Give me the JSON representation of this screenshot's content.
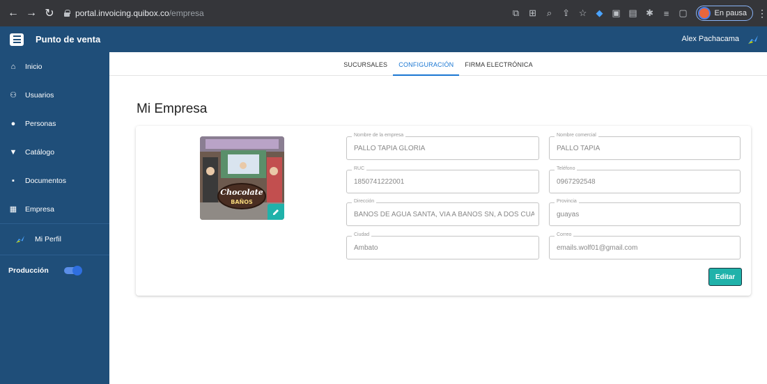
{
  "browser": {
    "url_host": "portal.invoicing.quibox.co",
    "url_path": "/empresa",
    "profile_status": "En pausa"
  },
  "header": {
    "title": "Punto de venta",
    "user_name": "Alex Pachacama"
  },
  "sidebar": {
    "items": [
      {
        "label": "Inicio",
        "icon": "home-icon"
      },
      {
        "label": "Usuarios",
        "icon": "users-icon"
      },
      {
        "label": "Personas",
        "icon": "person-icon"
      },
      {
        "label": "Catálogo",
        "icon": "cart-icon"
      },
      {
        "label": "Documentos",
        "icon": "document-icon"
      },
      {
        "label": "Empresa",
        "icon": "building-icon"
      }
    ],
    "profile_label": "Mi Perfil",
    "production_label": "Producción",
    "production_enabled": true
  },
  "tabs": [
    {
      "label": "SUCURSALES",
      "active": false
    },
    {
      "label": "CONFIGURACIÓN",
      "active": true
    },
    {
      "label": "FIRMA ELECTRÓNICA",
      "active": false
    }
  ],
  "page": {
    "title": "Mi Empresa",
    "photo_text": "Chocolate BAÑOS"
  },
  "form": {
    "nombre_empresa": {
      "label": "Nombre de la empresa",
      "value": "PALLO TAPIA GLORIA"
    },
    "nombre_comercial": {
      "label": "Nombre comercial",
      "value": "PALLO TAPIA"
    },
    "ruc": {
      "label": "RUC",
      "value": "1850741222001"
    },
    "telefono": {
      "label": "Teléfono",
      "value": "0967292548"
    },
    "direccion": {
      "label": "Dirección",
      "value": "BAÑOS DE AGUA SANTA, VIA A BAÑOS SN, A DOS CUADRAS"
    },
    "provincia": {
      "label": "Provincia",
      "value": "guayas"
    },
    "ciudad": {
      "label": "Ciudad",
      "value": "Ambato"
    },
    "correo": {
      "label": "Correo",
      "value": "emails.wolf01@gmail.com"
    },
    "edit_button": "Editar"
  },
  "colors": {
    "primary": "#1f4e79",
    "accent": "#20b2aa",
    "tab_active": "#1976d2"
  }
}
